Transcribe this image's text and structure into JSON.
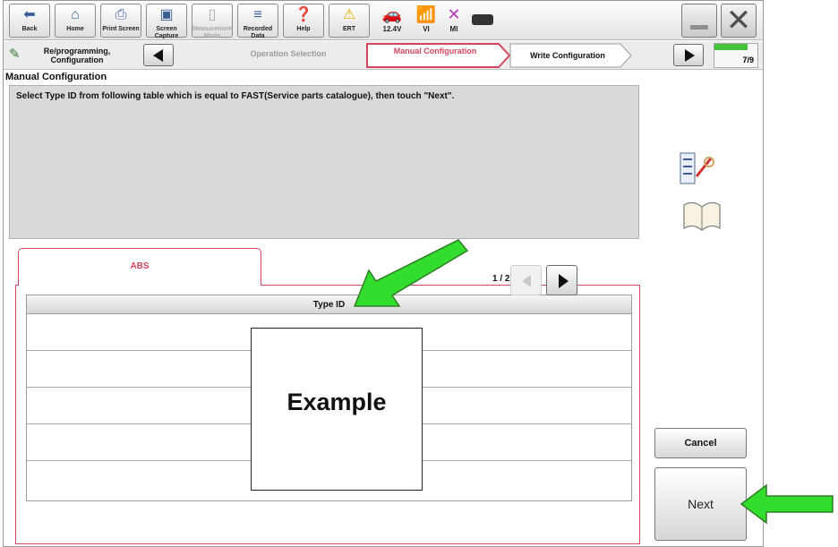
{
  "toolbar": {
    "back_label": "Back",
    "home_label": "Home",
    "print_screen_label": "Print Screen",
    "screen_capture_label": "Screen Capture",
    "measurement_mode_label": "Measurement Mode",
    "recorded_data_label": "Recorded Data",
    "help_label": "Help",
    "ert_label": "ERT",
    "voltage": "12.4V",
    "vi_label": "VI",
    "mi_label": "MI"
  },
  "breadcrumb": {
    "step1": "Re/programming, Configuration",
    "step2": "Operation Selection",
    "step3": "Manual Configuration",
    "step4": "Write Configuration",
    "progress": "7/9",
    "progress_fraction": 0.78
  },
  "section_title": "Manual Configuration",
  "instruction": "Select Type ID from following table which is equal to FAST(Service parts catalogue), then touch \"Next\".",
  "tabs": [
    {
      "label": "ABS"
    }
  ],
  "table": {
    "header": "Type ID",
    "rows": [
      "",
      "",
      "",
      "",
      ""
    ]
  },
  "pager": {
    "text": "1 / 2"
  },
  "buttons": {
    "cancel": "Cancel",
    "next": "Next"
  },
  "overlay": {
    "example_label": "Example"
  },
  "colors": {
    "accent": "#d5465e",
    "callout_arrow": "#33dd2e",
    "progress": "#46c23a"
  }
}
